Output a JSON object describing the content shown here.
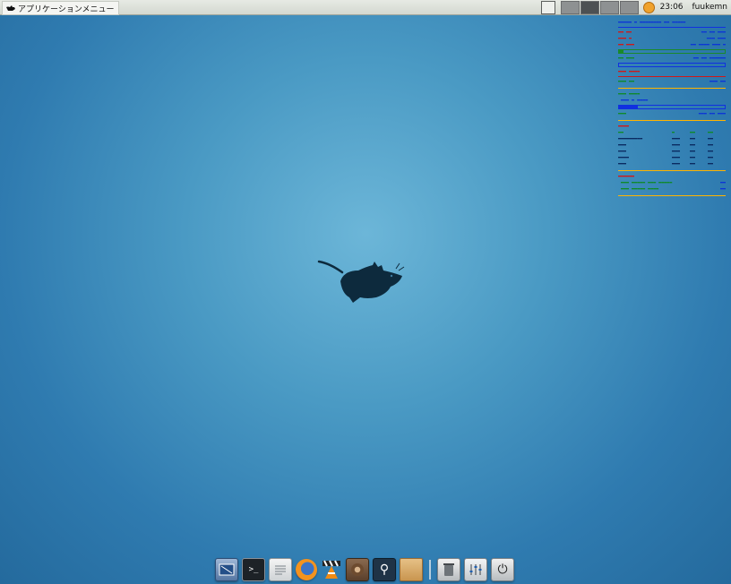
{
  "panel": {
    "app_menu_label": "アプリケーションメニュー",
    "clock": "23:06",
    "user": "fuukemn",
    "workspaces": [
      {
        "name": "ws-1"
      },
      {
        "name": "ws-2",
        "active": true
      },
      {
        "name": "ws-3"
      },
      {
        "name": "ws-4"
      }
    ]
  },
  "dock": {
    "items": [
      {
        "name": "screen-capture-icon"
      },
      {
        "name": "terminal-icon",
        "glyph": ">_"
      },
      {
        "name": "notes-icon"
      },
      {
        "name": "firefox-icon"
      },
      {
        "name": "vlc-icon"
      },
      {
        "name": "disk-utility-icon"
      },
      {
        "name": "search-icon",
        "glyph": "⚲"
      },
      {
        "name": "file-manager-icon"
      },
      {
        "name": "trash-icon"
      },
      {
        "name": "settings-mixer-icon"
      },
      {
        "name": "logout-icon",
        "glyph": "⏻"
      }
    ]
  },
  "colors": {
    "conky_blue": "#0c35d6",
    "conky_red": "#d01818",
    "conky_green": "#0f8a2a",
    "conky_rule": "#ffb400"
  }
}
